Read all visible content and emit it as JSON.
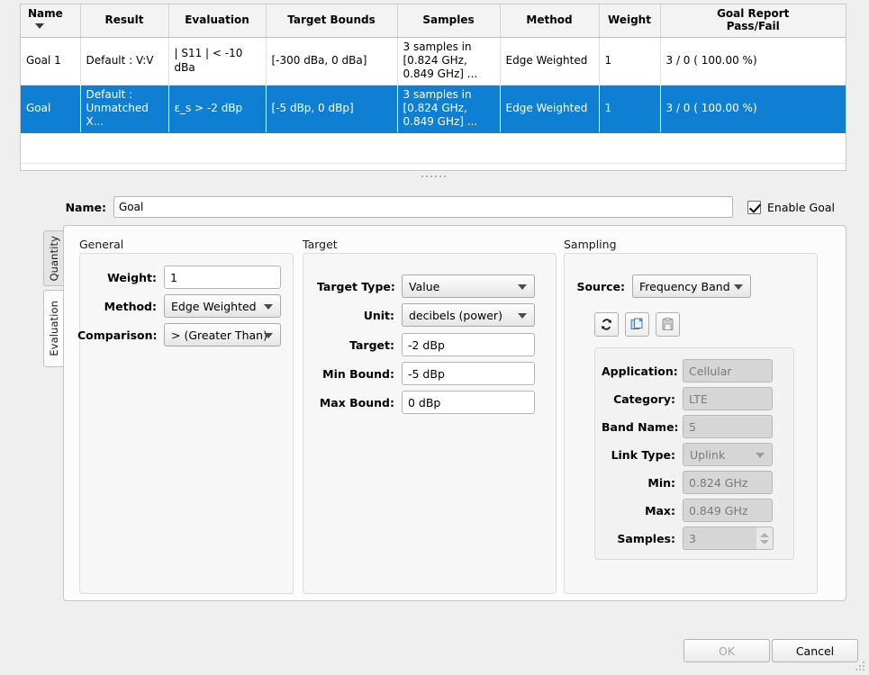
{
  "table": {
    "columns": [
      {
        "label": "Name",
        "sort": "desc"
      },
      {
        "label": "Result"
      },
      {
        "label": "Evaluation"
      },
      {
        "label": "Target Bounds"
      },
      {
        "label": "Samples"
      },
      {
        "label": "Method"
      },
      {
        "label": "Weight"
      },
      {
        "label": "Goal Report\nPass/Fail",
        "line1": "Goal Report",
        "line2": "Pass/Fail"
      }
    ],
    "rows": [
      {
        "name": "Goal 1",
        "result": "Default : V:V",
        "evaluation": "| S11 | < -10 dBa",
        "target_bounds": "[-300 dBa, 0 dBa]",
        "samples": "3 samples in [0.824 GHz, 0.849 GHz] ...",
        "method": "Edge Weighted",
        "weight": "1",
        "goal_report": "3 / 0 ( 100.00 %)",
        "selected": false
      },
      {
        "name": "Goal",
        "result": "Default : Unmatched X...",
        "evaluation": "ε_s > -2 dBp",
        "target_bounds": "[-5 dBp, 0 dBp]",
        "samples": "3 samples in [0.824 GHz, 0.849 GHz] ...",
        "method": "Edge Weighted",
        "weight": "1",
        "goal_report": "3 / 0 ( 100.00 %)",
        "selected": true
      }
    ],
    "selection_color": "#0f7fd4"
  },
  "name_row": {
    "label": "Name:",
    "value": "Goal",
    "placeholder": "",
    "enable_label": "Enable Goal",
    "enabled": true
  },
  "tabs": [
    {
      "label": "Quantity",
      "active": false
    },
    {
      "label": "Evaluation",
      "active": true
    }
  ],
  "general": {
    "title": "General",
    "weight_label": "Weight:",
    "weight_value": "1",
    "method_label": "Method:",
    "method_value": "Edge Weighted",
    "comparison_label": "Comparison:",
    "comparison_value": "> (Greater Than)"
  },
  "target": {
    "title": "Target",
    "target_type_label": "Target Type:",
    "target_type_value": "Value",
    "unit_label": "Unit:",
    "unit_value": "decibels (power)",
    "target_label": "Target:",
    "target_value": "-2 dBp",
    "min_bound_label": "Min Bound:",
    "min_bound_value": "-5 dBp",
    "max_bound_label": "Max Bound:",
    "max_bound_value": "0 dBp"
  },
  "sampling": {
    "title": "Sampling",
    "source_label": "Source:",
    "source_value": "Frequency Band",
    "icons": [
      {
        "name": "sync-icon",
        "title": "sync"
      },
      {
        "name": "copy-icon",
        "title": "copy"
      },
      {
        "name": "paste-icon",
        "title": "paste"
      }
    ],
    "band": {
      "application_label": "Application:",
      "application_value": "Cellular",
      "category_label": "Category:",
      "category_value": "LTE",
      "band_name_label": "Band Name:",
      "band_name_value": "5",
      "link_type_label": "Link Type:",
      "link_type_value": "Uplink",
      "min_label": "Min:",
      "min_value": "0.824 GHz",
      "max_label": "Max:",
      "max_value": "0.849 GHz",
      "samples_label": "Samples:",
      "samples_value": "3"
    }
  },
  "footer": {
    "ok_label": "OK",
    "ok_enabled": false,
    "cancel_label": "Cancel",
    "cancel_enabled": true
  }
}
